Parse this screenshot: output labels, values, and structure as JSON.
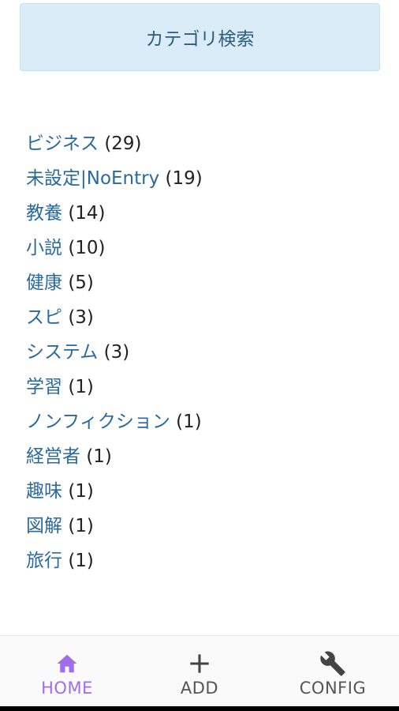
{
  "search": {
    "label": "カテゴリ検索"
  },
  "categories": [
    {
      "name": "ビジネス",
      "count": "(29)"
    },
    {
      "name": "未設定|NoEntry",
      "count": "(19)"
    },
    {
      "name": "教養",
      "count": "(14)"
    },
    {
      "name": "小説",
      "count": "(10)"
    },
    {
      "name": "健康",
      "count": "(5)"
    },
    {
      "name": "スピ",
      "count": "(3)"
    },
    {
      "name": "システム",
      "count": "(3)"
    },
    {
      "name": "学習",
      "count": "(1)"
    },
    {
      "name": "ノンフィクション",
      "count": "(1)"
    },
    {
      "name": "経営者",
      "count": "(1)"
    },
    {
      "name": "趣味",
      "count": "(1)"
    },
    {
      "name": "図解",
      "count": "(1)"
    },
    {
      "name": "旅行",
      "count": "(1)"
    }
  ],
  "nav": {
    "home": {
      "label": "HOME",
      "icon": "home-icon",
      "active": true
    },
    "add": {
      "label": "ADD",
      "icon": "plus-icon"
    },
    "config": {
      "label": "CONFIG",
      "icon": "wrench-icon"
    }
  },
  "colors": {
    "accent": "#a06ee9",
    "link": "#2a6a9e",
    "search_bg": "#d9ecf7"
  }
}
